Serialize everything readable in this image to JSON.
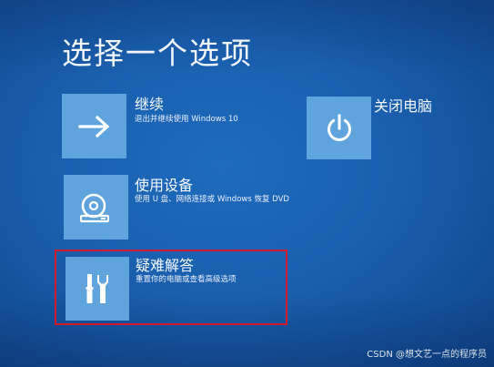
{
  "title": "选择一个选项",
  "options": {
    "continue": {
      "title": "继续",
      "desc": "退出并继续使用 Windows 10",
      "icon": "arrow-right-icon"
    },
    "shutdown": {
      "title": "关闭电脑",
      "icon": "power-icon"
    },
    "device": {
      "title": "使用设备",
      "desc": "使用 U 盘、网络连接或 Windows 恢复 DVD",
      "icon": "disc-drive-icon"
    },
    "troubleshoot": {
      "title": "疑难解答",
      "desc": "重置你的电脑或查看高级选项",
      "icon": "tools-icon"
    }
  },
  "colors": {
    "background": "#1a5fae",
    "tile": "#5fa4dc",
    "highlight": "#d21a2a"
  },
  "watermark": "CSDN @想文艺一点的程序员"
}
